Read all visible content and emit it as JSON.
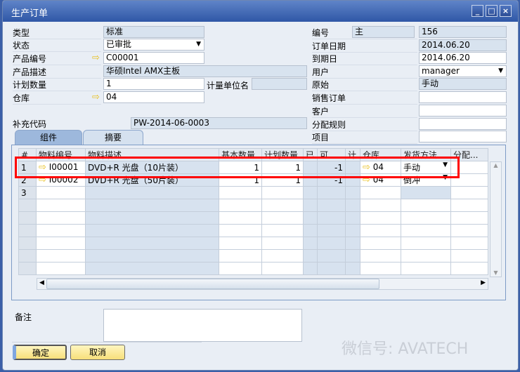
{
  "window": {
    "title": "生产订单"
  },
  "left": {
    "type_label": "类型",
    "type_value": "标准",
    "status_label": "状态",
    "status_value": "已审批",
    "product_no_label": "产品编号",
    "product_no_value": "C00001",
    "product_desc_label": "产品描述",
    "product_desc_value": "华硕Intel AMX主板",
    "planned_qty_label": "计划数量",
    "planned_qty_value": "1",
    "uom_label": "计量单位名",
    "warehouse_label": "仓库",
    "warehouse_value": "04",
    "supp_code_label": "补充代码",
    "supp_code_value": "PW-2014-06-0003"
  },
  "right": {
    "no_label": "编号",
    "series_value": "主",
    "no_value": "156",
    "order_date_label": "订单日期",
    "order_date_value": "2014.06.20",
    "due_date_label": "到期日",
    "due_date_value": "2014.06.20",
    "user_label": "用户",
    "user_value": "manager",
    "origin_label": "原始",
    "origin_value": "手动",
    "sales_order_label": "销售订单",
    "customer_label": "客户",
    "dist_rule_label": "分配规则",
    "project_label": "项目"
  },
  "tabs": [
    "组件",
    "摘要"
  ],
  "grid": {
    "headers": [
      "#",
      "物料编号",
      "物料描述",
      "基本数量",
      "计划数量",
      "已",
      "可",
      "计",
      "仓库",
      "发货方法",
      "分配..."
    ],
    "rows": [
      {
        "n": "1",
        "item": "I00001",
        "desc": "DVD+R 光盘（10片装）",
        "base": "1",
        "planned": "1",
        "avail": "-1",
        "wh": "04",
        "method": "手动"
      },
      {
        "n": "2",
        "item": "I00002",
        "desc": "DVD+R 光盘（50片装）",
        "base": "1",
        "planned": "1",
        "avail": "-1",
        "wh": "04",
        "method": "倒冲"
      },
      {
        "n": "3"
      }
    ]
  },
  "remarks_label": "备注",
  "buttons": {
    "ok": "确定",
    "cancel": "取消"
  },
  "watermark": "微信号: AVATECH"
}
